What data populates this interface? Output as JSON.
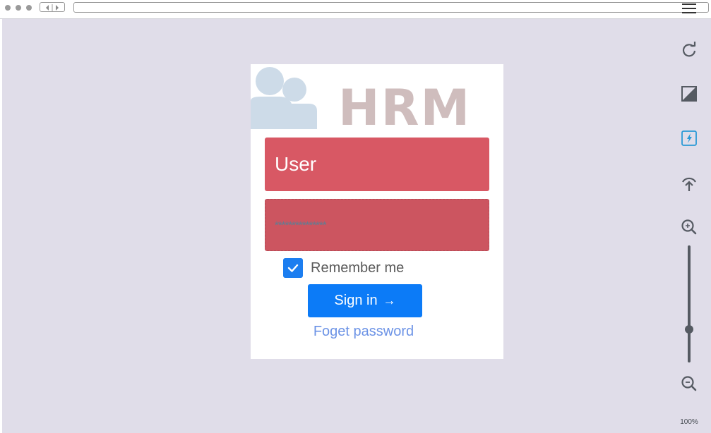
{
  "login": {
    "logo_text": "HRM",
    "username_value": "User",
    "password_value": "***************",
    "remember_label": "Remember me",
    "remember_checked": true,
    "signin_label": "Sign in",
    "forgot_label": "Foget password"
  },
  "toolbar": {
    "icons": [
      "refresh-icon",
      "contrast-icon",
      "flash-icon",
      "upload-icon",
      "zoom-in-icon",
      "zoom-out-icon"
    ],
    "zoom_label": "100%"
  },
  "colors": {
    "viewport_bg": "#e0dde9",
    "input_bg": "#d85864",
    "primary": "#0c7bf7",
    "link": "#6c93e6"
  }
}
